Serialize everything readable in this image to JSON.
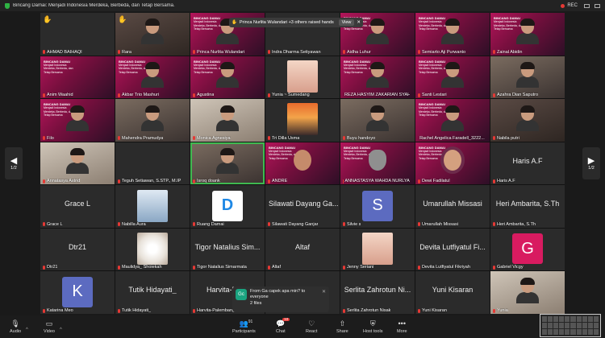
{
  "topbar": {
    "title": "Bincang Damai: Menjadi Indonesia Merdeka, Berbeda, dan Tetap Bersama.",
    "rec": "REC"
  },
  "raise_banner": {
    "text": "Princa Nurlita Wulandari +3 others raised hands",
    "view": "View"
  },
  "pager": {
    "left_label": "1/2",
    "right_label": "1/2"
  },
  "tiles": [
    {
      "name": "AHMAD BAIHAQI",
      "kind": "blank",
      "hand": true
    },
    {
      "name": "Rara",
      "kind": "video",
      "hand": true
    },
    {
      "name": "Princa Nurlita Wulandari",
      "kind": "pink-video"
    },
    {
      "name": "Indra Dharma Setiyawan",
      "kind": "blank"
    },
    {
      "name": "Aidha Luhur",
      "kind": "pink-video"
    },
    {
      "name": "Semiarto Aji Purwanto",
      "kind": "pink-video"
    },
    {
      "name": "Zainal Abidin",
      "kind": "pink-video"
    },
    {
      "name": "Anim Waahid",
      "kind": "pink"
    },
    {
      "name": "Akbar Trio Mashuri",
      "kind": "pink-video"
    },
    {
      "name": "Agustina",
      "kind": "pink-video"
    },
    {
      "name": "Yunia ~ Sumedang",
      "kind": "photo-baby"
    },
    {
      "name": "REZA HASYIM ZAKARIAN SYAH",
      "kind": "pink-video"
    },
    {
      "name": "Santi Lestari",
      "kind": "pink-video"
    },
    {
      "name": "Azahra Dian Saputro",
      "kind": "video2"
    },
    {
      "name": "Filo",
      "kind": "pink-video"
    },
    {
      "name": "Mahendra Pramudya",
      "kind": "video2"
    },
    {
      "name": "Monica Agnesiya",
      "kind": "video3"
    },
    {
      "name": "Tri Dilla Usma",
      "kind": "sunset"
    },
    {
      "name": "Buyu handoyo",
      "kind": "video2"
    },
    {
      "name": "Rachel Angelica Faradell_3222...",
      "kind": "pink-video"
    },
    {
      "name": "Nabila putri",
      "kind": "video"
    },
    {
      "name": "Annatasya Astrid",
      "kind": "video3"
    },
    {
      "name": "Teguh Setiawan, S.STP., M.IP",
      "kind": "blank"
    },
    {
      "name": "Isroq doank",
      "kind": "video2",
      "speaking": true
    },
    {
      "name": "ANDRE",
      "kind": "pink-memoji"
    },
    {
      "name": "ANNASTASYA WAHDA NURLYA",
      "kind": "pink-cat"
    },
    {
      "name": "Dewi Fadilatul",
      "kind": "pink-hijab"
    },
    {
      "name": "Haris A.F",
      "kind": "blank",
      "big": "Haris A.F"
    },
    {
      "name": "Grace L",
      "kind": "blank",
      "big": "Grace L"
    },
    {
      "name": "Nabilla Aura",
      "kind": "photo-girl"
    },
    {
      "name": "Ruang Damai",
      "kind": "logo-d"
    },
    {
      "name": "Silawati Dayang Ganjar",
      "kind": "blank",
      "big": "Silawati Dayang Ga..."
    },
    {
      "name": "Silvie s",
      "kind": "letter",
      "letter": "S",
      "color": "#5c6bc0"
    },
    {
      "name": "Umarullah Missasi",
      "kind": "blank",
      "big": "Umarullah Missasi"
    },
    {
      "name": "Heri Ambarita, S.Th",
      "kind": "blank",
      "big": "Heri Ambarita, S.Th"
    },
    {
      "name": "Dtr21",
      "kind": "blank",
      "big": "Dtr21"
    },
    {
      "name": "Maulidya_ Shoiekah",
      "kind": "photo-flower"
    },
    {
      "name": "Tigor Natalius Simarmata",
      "kind": "blank",
      "big": "Tigor Natalius Sim..."
    },
    {
      "name": "Altaf",
      "kind": "blank",
      "big": "Altaf"
    },
    {
      "name": "Jenny Seriani",
      "kind": "photo-baby"
    },
    {
      "name": "Devita Lutfiyatul Fikriyah",
      "kind": "blank",
      "big": "Devita Lutfiyatul Fi..."
    },
    {
      "name": "Gabriel Vicgy",
      "kind": "letter",
      "letter": "G",
      "color": "#d81b60"
    },
    {
      "name": "Katarina Meo",
      "kind": "letter",
      "letter": "K",
      "color": "#5c6bc0"
    },
    {
      "name": "Tutik Hidayati_",
      "kind": "blank",
      "big": "Tutik Hidayati_"
    },
    {
      "name": "Harvita-Palembang",
      "kind": "blank",
      "big": "Harvita-Pal..."
    },
    {
      "name": "",
      "kind": "blank"
    },
    {
      "name": "Serlita Zahrotun Nisak",
      "kind": "blank",
      "big": "Serlita Zahrotun Ni..."
    },
    {
      "name": "Yuni Kisaran",
      "kind": "blank",
      "big": "Yuni Kisaran"
    },
    {
      "name": "Yunia",
      "kind": "video3"
    }
  ],
  "chat_popup": {
    "avatar": "Gc",
    "line1": "From Ga capek apa min? to",
    "line2": "everyone",
    "line3": "2 files"
  },
  "toolbar": {
    "audio": "Audio",
    "video": "Video",
    "participants": "Participants",
    "participants_count": "91",
    "chat": "Chat",
    "chat_badge": "10",
    "react": "React",
    "share": "Share",
    "host_tools": "Host tools",
    "more": "More"
  },
  "slide": {
    "title": "BINCANG DAMAI",
    "sub": "Menjadi Indonesia Merdeka, Berbeda, dan Tetap Bersama"
  }
}
